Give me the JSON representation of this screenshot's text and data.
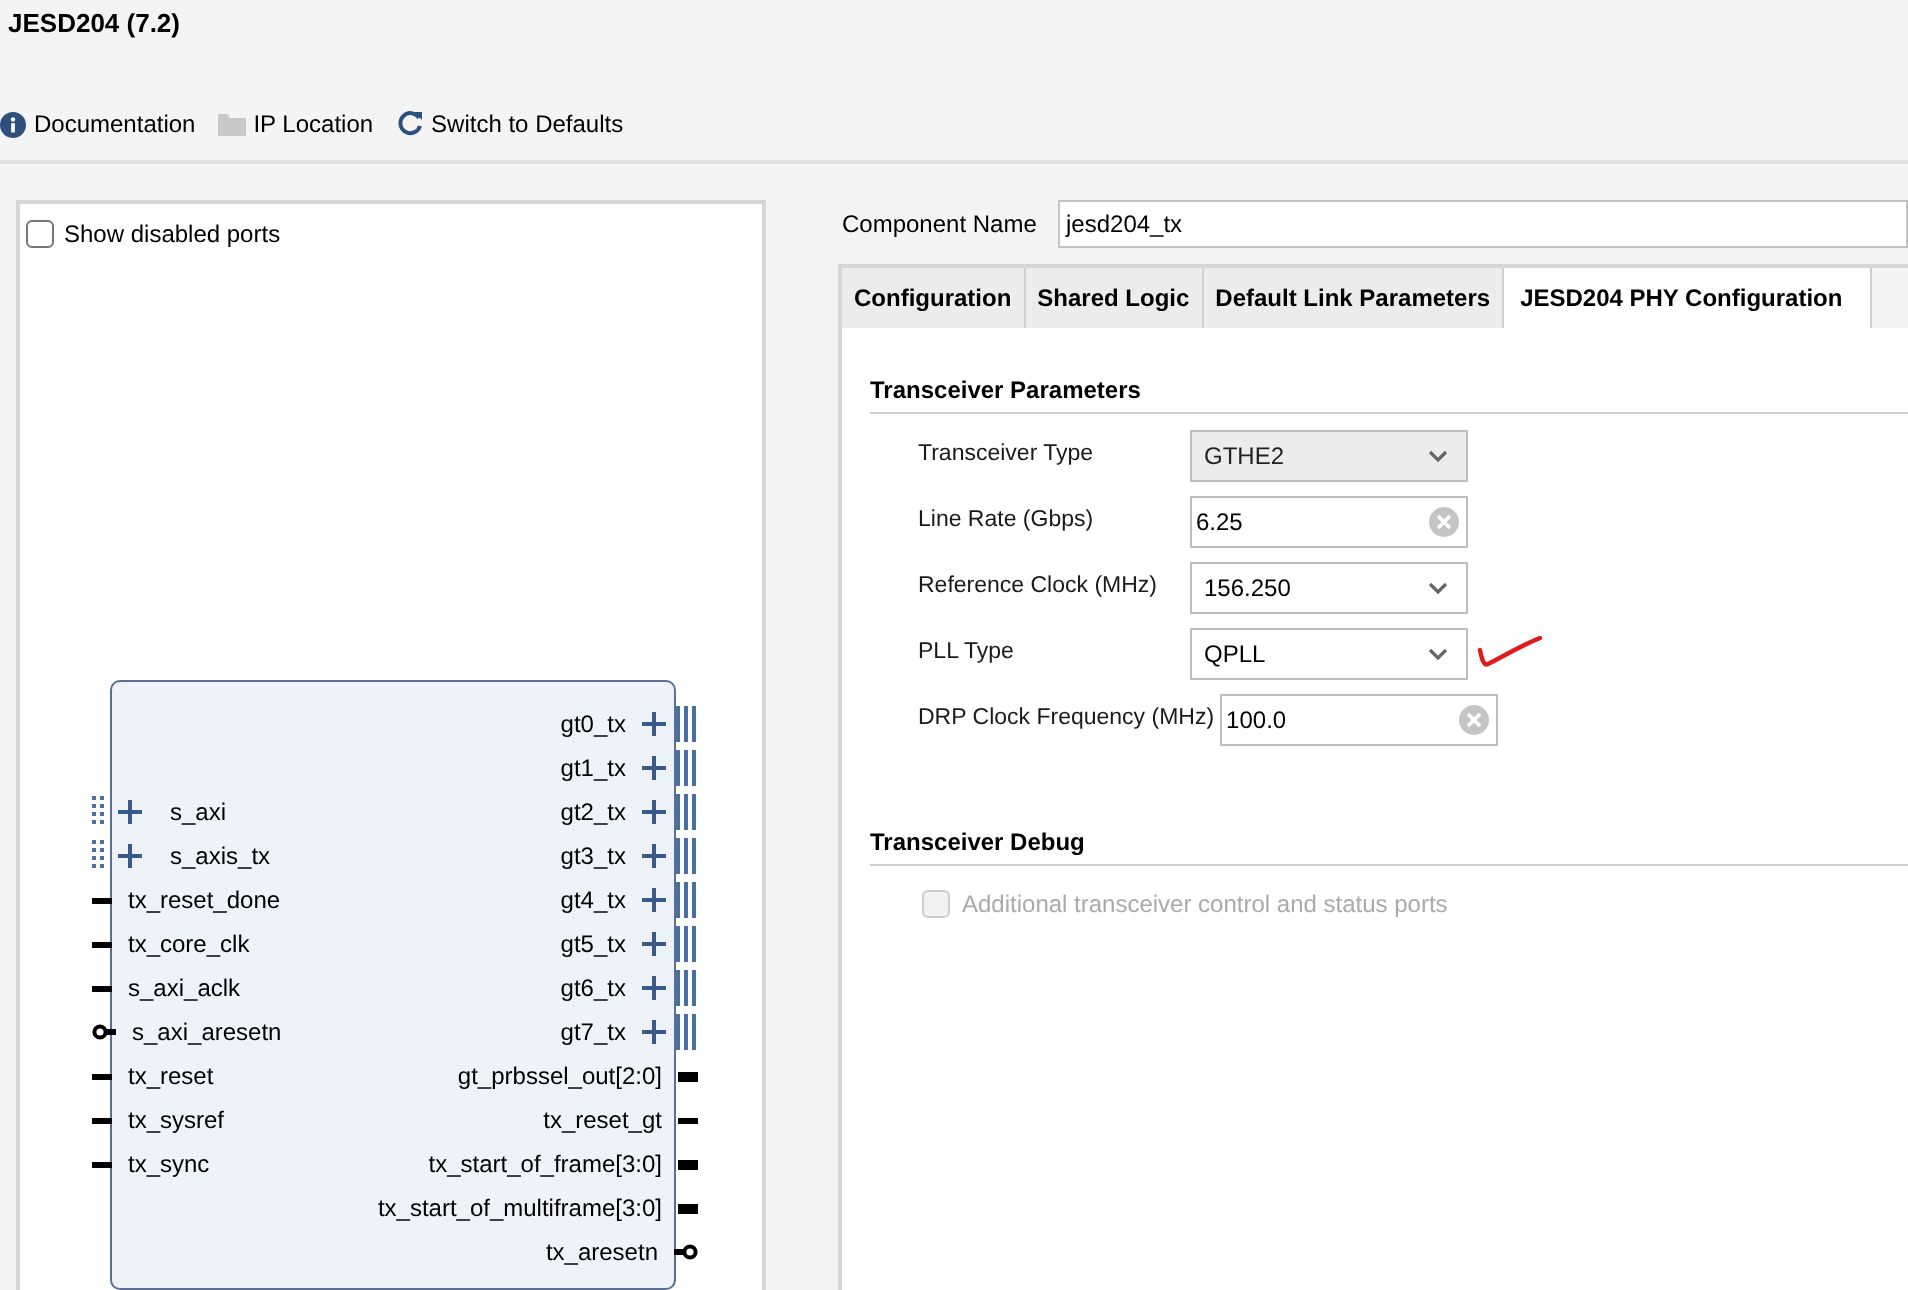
{
  "window": {
    "title": "JESD204 (7.2)"
  },
  "toolbar": [
    {
      "kind": "info",
      "label": "Documentation",
      "disabled": false
    },
    {
      "kind": "folder",
      "label": "IP Location",
      "disabled": false
    },
    {
      "kind": "refresh",
      "label": "Switch to Defaults",
      "disabled": false
    }
  ],
  "symbol_panel": {
    "show_disabled_ports": {
      "label": "Show disabled ports",
      "checked": false
    },
    "left_ports": [
      {
        "name": "s_axi",
        "kind": "bus"
      },
      {
        "name": "s_axis_tx",
        "kind": "bus"
      },
      {
        "name": "tx_reset_done",
        "kind": "wire"
      },
      {
        "name": "tx_core_clk",
        "kind": "wire"
      },
      {
        "name": "s_axi_aclk",
        "kind": "wire"
      },
      {
        "name": "s_axi_aresetn",
        "kind": "negated"
      },
      {
        "name": "tx_reset",
        "kind": "wire"
      },
      {
        "name": "tx_sysref",
        "kind": "wire"
      },
      {
        "name": "tx_sync",
        "kind": "wire"
      }
    ],
    "right_ports": [
      {
        "name": "gt0_tx",
        "kind": "bus"
      },
      {
        "name": "gt1_tx",
        "kind": "bus"
      },
      {
        "name": "gt2_tx",
        "kind": "bus"
      },
      {
        "name": "gt3_tx",
        "kind": "bus"
      },
      {
        "name": "gt4_tx",
        "kind": "bus"
      },
      {
        "name": "gt5_tx",
        "kind": "bus"
      },
      {
        "name": "gt6_tx",
        "kind": "bus"
      },
      {
        "name": "gt7_tx",
        "kind": "bus"
      },
      {
        "name": "gt_prbssel_out[2:0]",
        "kind": "vector"
      },
      {
        "name": "tx_reset_gt",
        "kind": "wire"
      },
      {
        "name": "tx_start_of_frame[3:0]",
        "kind": "vector"
      },
      {
        "name": "tx_start_of_multiframe[3:0]",
        "kind": "vector"
      },
      {
        "name": "tx_aresetn",
        "kind": "negated"
      }
    ]
  },
  "component_name": {
    "label": "Component Name",
    "value": "jesd204_tx"
  },
  "tabs": [
    {
      "label": "Configuration",
      "selected": false
    },
    {
      "label": "Shared Logic",
      "selected": false
    },
    {
      "label": "Default Link Parameters",
      "selected": false
    },
    {
      "label": "JESD204 PHY Configuration",
      "selected": true
    }
  ],
  "sections": [
    {
      "title": "Transceiver Parameters",
      "fields": [
        {
          "label": "Transceiver Type",
          "kind": "combo",
          "value": "GTHE2",
          "disabled": true,
          "annotated": false
        },
        {
          "label": "Line Rate (Gbps)",
          "kind": "text",
          "value": "6.25",
          "disabled": false,
          "annotated": false
        },
        {
          "label": "Reference Clock (MHz)",
          "kind": "combo",
          "value": "156.250",
          "disabled": false,
          "annotated": false
        },
        {
          "label": "PLL Type",
          "kind": "combo",
          "value": "QPLL",
          "disabled": false,
          "annotated": true
        },
        {
          "label": "DRP Clock Frequency (MHz)",
          "kind": "text",
          "value": "100.0",
          "disabled": false,
          "annotated": false
        }
      ]
    },
    {
      "title": "Transceiver Debug",
      "fields": [
        {
          "label": "Additional transceiver control and status ports",
          "kind": "checkbox",
          "checked": false,
          "disabled": true
        }
      ]
    }
  ]
}
